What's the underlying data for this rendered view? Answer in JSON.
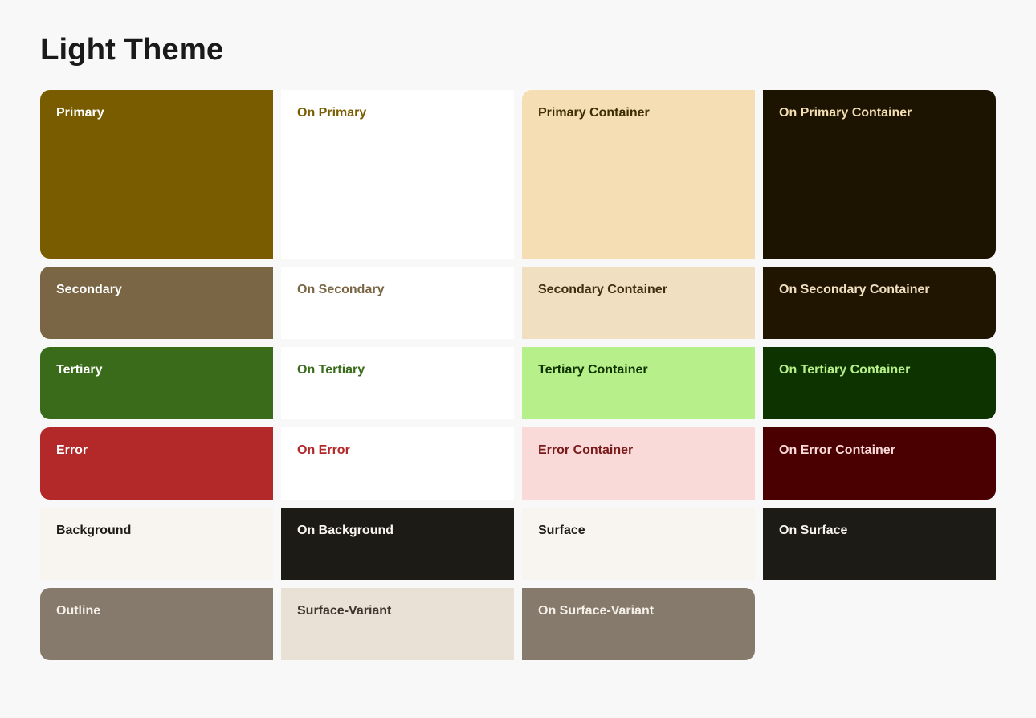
{
  "title": "Light Theme",
  "rows": [
    {
      "cells": [
        {
          "id": "primary",
          "label": "Primary",
          "bg": "#7a5c00",
          "color": "#ffffff",
          "tall": true,
          "roundTL": true,
          "roundBL": true
        },
        {
          "id": "on-primary",
          "label": "On Primary",
          "bg": "#ffffff",
          "color": "#7a5c00",
          "tall": true
        },
        {
          "id": "primary-container",
          "label": "Primary Container",
          "bg": "#f5deb3",
          "color": "#3d2e00",
          "tall": true,
          "roundTL": true
        },
        {
          "id": "on-primary-container",
          "label": "On Primary Container",
          "bg": "#1c1400",
          "color": "#f5deb3",
          "tall": true,
          "roundTR": true,
          "roundBR": true
        }
      ]
    },
    {
      "cells": [
        {
          "id": "secondary",
          "label": "Secondary",
          "bg": "#7a6645",
          "color": "#ffffff",
          "roundTL": true,
          "roundBL": true
        },
        {
          "id": "on-secondary",
          "label": "On Secondary",
          "bg": "#ffffff",
          "color": "#7a6645"
        },
        {
          "id": "secondary-container",
          "label": "Secondary Container",
          "bg": "#f0dfc0",
          "color": "#3d2f10"
        },
        {
          "id": "on-secondary-container",
          "label": "On Secondary Container",
          "bg": "#1f1500",
          "color": "#f0dfc0",
          "roundTR": true,
          "roundBR": true
        }
      ]
    },
    {
      "cells": [
        {
          "id": "tertiary",
          "label": "Tertiary",
          "bg": "#3a6b1a",
          "color": "#ffffff",
          "roundTL": true,
          "roundBL": true
        },
        {
          "id": "on-tertiary",
          "label": "On Tertiary",
          "bg": "#ffffff",
          "color": "#3a6b1a"
        },
        {
          "id": "tertiary-container",
          "label": "Tertiary Container",
          "bg": "#b7f08a",
          "color": "#0f3300"
        },
        {
          "id": "on-tertiary-container",
          "label": "On Tertiary Container",
          "bg": "#0d3300",
          "color": "#b7f08a",
          "roundTR": true,
          "roundBR": true
        }
      ]
    },
    {
      "cells": [
        {
          "id": "error",
          "label": "Error",
          "bg": "#b32828",
          "color": "#ffffff",
          "roundTL": true,
          "roundBL": true
        },
        {
          "id": "on-error",
          "label": "On Error",
          "bg": "#ffffff",
          "color": "#b32828"
        },
        {
          "id": "error-container",
          "label": "Error Container",
          "bg": "#fad9d9",
          "color": "#7a1a1a"
        },
        {
          "id": "on-error-container",
          "label": "On Error Container",
          "bg": "#4a0000",
          "color": "#fad9d9",
          "roundTR": true,
          "roundBR": true
        }
      ]
    },
    {
      "cells": [
        {
          "id": "background",
          "label": "Background",
          "bg": "#f8f4ef",
          "color": "#1c1b16"
        },
        {
          "id": "on-background",
          "label": "On Background",
          "bg": "#1c1b16",
          "color": "#f8f4ef",
          "span": 1
        },
        {
          "id": "surface",
          "label": "Surface",
          "bg": "#f8f4ef",
          "color": "#1c1b16"
        },
        {
          "id": "on-surface",
          "label": "On Surface",
          "bg": "#1c1b16",
          "color": "#f8f4ef"
        }
      ]
    },
    {
      "cells": [
        {
          "id": "outline",
          "label": "Outline",
          "bg": "#857a6c",
          "color": "#f5f0e8",
          "span": 2,
          "roundTL": true,
          "roundBL": true
        },
        {
          "id": "surface-variant",
          "label": "Surface-Variant",
          "bg": "#e9e1d5",
          "color": "#3d3730"
        },
        {
          "id": "on-surface-variant",
          "label": "On Surface-Variant",
          "bg": "#857a6c",
          "color": "#f5f0e8",
          "roundTR": true,
          "roundBR": true
        }
      ]
    }
  ]
}
